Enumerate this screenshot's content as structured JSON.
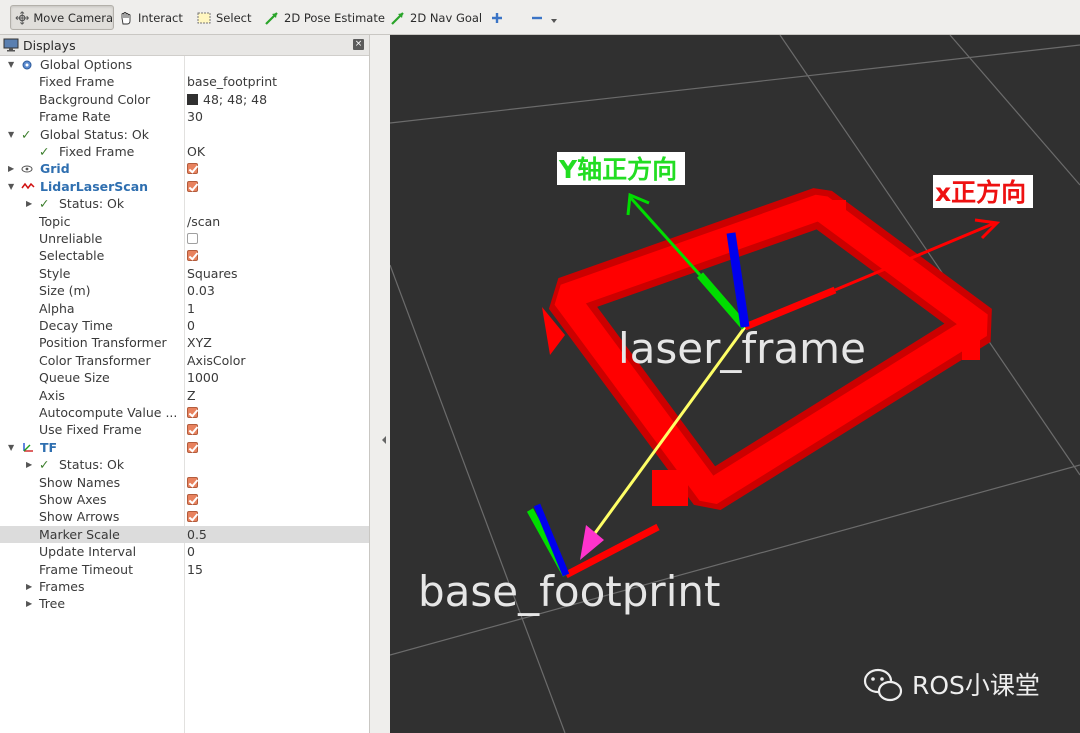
{
  "toolbar": {
    "move_camera": "Move Camera",
    "interact": "Interact",
    "select": "Select",
    "pose_estimate": "2D Pose Estimate",
    "nav_goal": "2D Nav Goal"
  },
  "panel": {
    "title": "Displays",
    "close": "×"
  },
  "tree": [
    {
      "label": "Global Options",
      "value": "",
      "indent": 1,
      "arrow": "▼",
      "icon": "gear-icon"
    },
    {
      "label": "Fixed Frame",
      "value": "base_footprint",
      "indent": 2
    },
    {
      "label": "Background Color",
      "value": "48; 48; 48",
      "indent": 2,
      "swatch": true
    },
    {
      "label": "Frame Rate",
      "value": "30",
      "indent": 2
    },
    {
      "label": "Global Status: Ok",
      "value": "",
      "indent": 1,
      "arrow": "▼",
      "icon": "check-icon"
    },
    {
      "label": "Fixed Frame",
      "value": "OK",
      "indent": 2,
      "icon": "check-icon"
    },
    {
      "label": "Grid",
      "value": "",
      "indent": 1,
      "arrow": "▶",
      "icon": "grid-icon",
      "blue": true,
      "checkbox": true
    },
    {
      "label": "LidarLaserScan",
      "value": "",
      "indent": 1,
      "arrow": "▼",
      "icon": "laserscan-icon",
      "blue": true,
      "checkbox": true
    },
    {
      "label": "Status: Ok",
      "value": "",
      "indent": 2,
      "arrow": "▶",
      "icon": "check-icon"
    },
    {
      "label": "Topic",
      "value": "/scan",
      "indent": 2
    },
    {
      "label": "Unreliable",
      "value": "",
      "indent": 2,
      "checkbox_off": true
    },
    {
      "label": "Selectable",
      "value": "",
      "indent": 2,
      "checkbox": true
    },
    {
      "label": "Style",
      "value": "Squares",
      "indent": 2
    },
    {
      "label": "Size (m)",
      "value": "0.03",
      "indent": 2
    },
    {
      "label": "Alpha",
      "value": "1",
      "indent": 2
    },
    {
      "label": "Decay Time",
      "value": "0",
      "indent": 2
    },
    {
      "label": "Position Transformer",
      "value": "XYZ",
      "indent": 2
    },
    {
      "label": "Color Transformer",
      "value": "AxisColor",
      "indent": 2
    },
    {
      "label": "Queue Size",
      "value": "1000",
      "indent": 2
    },
    {
      "label": "Axis",
      "value": "Z",
      "indent": 2
    },
    {
      "label": "Autocompute Value ...",
      "value": "",
      "indent": 2,
      "checkbox": true
    },
    {
      "label": "Use Fixed Frame",
      "value": "",
      "indent": 2,
      "checkbox": true
    },
    {
      "label": "TF",
      "value": "",
      "indent": 1,
      "arrow": "▼",
      "icon": "tf-icon",
      "blue": true,
      "checkbox": true
    },
    {
      "label": "Status: Ok",
      "value": "",
      "indent": 2,
      "arrow": "▶",
      "icon": "check-icon"
    },
    {
      "label": "Show Names",
      "value": "",
      "indent": 2,
      "checkbox": true
    },
    {
      "label": "Show Axes",
      "value": "",
      "indent": 2,
      "checkbox": true
    },
    {
      "label": "Show Arrows",
      "value": "",
      "indent": 2,
      "checkbox": true
    },
    {
      "label": "Marker Scale",
      "value": "0.5",
      "indent": 2,
      "highlight": true
    },
    {
      "label": "Update Interval",
      "value": "0",
      "indent": 2
    },
    {
      "label": "Frame Timeout",
      "value": "15",
      "indent": 2
    },
    {
      "label": "Frames",
      "value": "",
      "indent": 2,
      "arrow": "▶"
    },
    {
      "label": "Tree",
      "value": "",
      "indent": 2,
      "arrow": "▶"
    }
  ],
  "colors": {
    "background": "#303030",
    "laser": "#ff0000",
    "link": "#ffff66",
    "y_axis": "#00dd00",
    "z_axis": "#0000ee"
  },
  "viewport": {
    "laser_frame_label": "laser_frame",
    "base_footprint_label": "base_footprint",
    "y_annotation": "Y轴正方向",
    "x_annotation": "x正方向",
    "watermark": "ROS小课堂"
  }
}
